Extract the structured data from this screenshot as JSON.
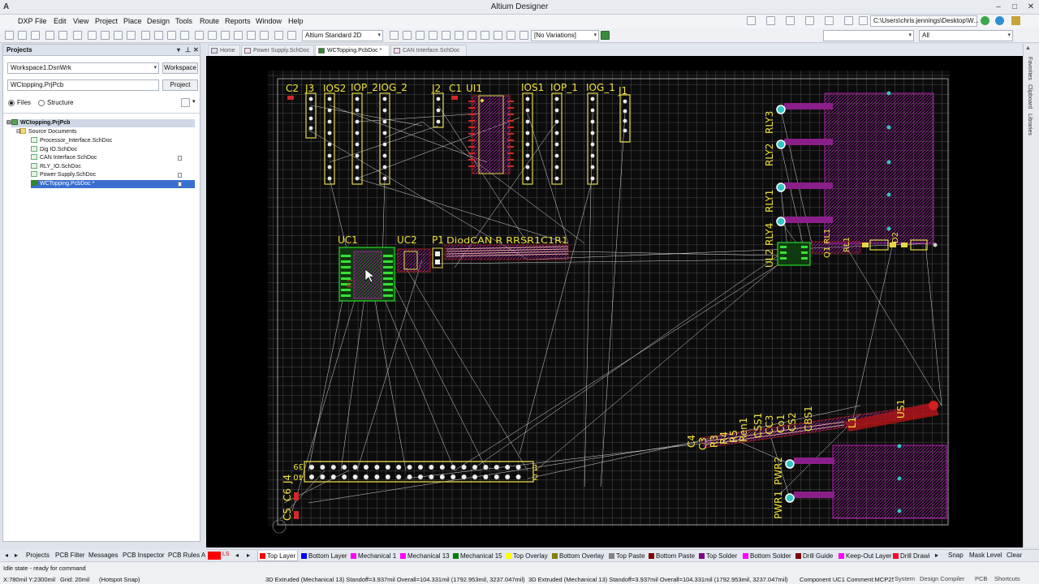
{
  "window": {
    "title": "Altium Designer"
  },
  "menu": [
    "DXP",
    "File",
    "Edit",
    "View",
    "Project",
    "Place",
    "Design",
    "Tools",
    "Route",
    "Reports",
    "Window",
    "Help"
  ],
  "toolbar": {
    "view_config": "Altium Standard 2D",
    "variations": "[No Variations]",
    "path": "C:\\Users\\chris.jennings\\Desktop\\W...",
    "filter_all": "All"
  },
  "projects_panel": {
    "title": "Projects",
    "workspace_combo": "Workspace1.DsnWrk",
    "workspace_button": "Workspace",
    "project_field": "WCtopping.PrjPcb",
    "project_button": "Project",
    "view_files": "Files",
    "view_structure": "Structure",
    "tree": {
      "project": "WCtopping.PrjPcb",
      "folder": "Source Documents",
      "docs": [
        "Processor_Interface.SchDoc",
        "Dig IO.SchDoc",
        "CAN Interface.SchDoc",
        "RLY_IO.SchDoc",
        "Power Supply.SchDoc",
        "WCTopping.PcbDoc *"
      ]
    }
  },
  "doc_tabs": [
    "Home",
    "Power Supply.SchDoc",
    "WCTopping.PcbDoc *",
    "CAN Interface.SchDoc"
  ],
  "right_strip": [
    "Favorites",
    "Clipboard",
    "Libraries"
  ],
  "bottom_panels": [
    "Projects",
    "PCB Filter",
    "Messages",
    "PCB Inspector",
    "PCB Rules An"
  ],
  "layers": {
    "tabs": [
      {
        "name": "Top Layer",
        "color": "#ff0000"
      },
      {
        "name": "Bottom Layer",
        "color": "#0000ff"
      },
      {
        "name": "Mechanical 1",
        "color": "#ff00ff"
      },
      {
        "name": "Mechanical 13",
        "color": "#ff00ff"
      },
      {
        "name": "Mechanical 15",
        "color": "#008000"
      },
      {
        "name": "Top Overlay",
        "color": "#ffff00"
      },
      {
        "name": "Bottom Overlay",
        "color": "#808000"
      },
      {
        "name": "Top Paste",
        "color": "#808080"
      },
      {
        "name": "Bottom Paste",
        "color": "#800000"
      },
      {
        "name": "Top Solder",
        "color": "#800080"
      },
      {
        "name": "Bottom Solder",
        "color": "#ff00ff"
      },
      {
        "name": "Drill Guide",
        "color": "#800000"
      },
      {
        "name": "Keep-Out Layer",
        "color": "#ff00ff"
      },
      {
        "name": "Drill Drawi",
        "color": "#ff002a"
      }
    ],
    "current_color": "#ff0000",
    "ls": "LS",
    "snap": "Snap",
    "mask_level": "Mask Level",
    "clear": "Clear"
  },
  "status": {
    "state": "Idle state - ready for command",
    "coords": "X:780mil Y:2300mil",
    "grid": "Grid: 20mil",
    "snap": "(Hotspot Snap)",
    "info1": "3D Extruded  (Mechanical 13)  Standoff=3.937mil  Overall=104.331mil  (1792.953mil, 3237.047mil)",
    "info2": "3D Extruded  (Mechanical 13)  Standoff=3.937mil  Overall=104.331mil  (1792.953mil, 3237.047mil)",
    "component": "Component UC1 Comment:MCP25",
    "buttons": [
      "System",
      "Design Compiler",
      "PCB",
      "Shortcuts"
    ]
  },
  "board": {
    "designators": {
      "c2": "C2",
      "j3": "J3",
      "ios2": "IOS2",
      "iop2": "IOP_2",
      "iog2": "IOG_2",
      "j2": "J2",
      "c1": "C1",
      "ui1": "UI1",
      "ios1": "IOS1",
      "iop1": "IOP_1",
      "iog1": "IOG_1",
      "j1": "J1",
      "uc1": "UC1",
      "uc2": "UC2",
      "p1": "P1",
      "dense": "DiodCAN R RRSR1C1R1",
      "rly3": "RLY3",
      "rly2": "RLY2",
      "rly1": "RLY1",
      "rly4": "RLY4",
      "ul2": "UL2",
      "rl1": "RL1",
      "qrl": "Q1 RL1",
      "d2": "D2",
      "c4": "C4",
      "c3": "C3",
      "r3": "R3",
      "r4": "R4",
      "r5": "R5",
      "ren1": "Ren1",
      "css1": "CSS1",
      "cc3": "CC3",
      "co1": "Co1",
      "cs2": "CS2",
      "cbs1": "CBS1",
      "l1": "L1",
      "us1": "US1",
      "pwr2": "PWR2",
      "pwr1": "PWR1",
      "j4": "J4",
      "c6": "C6",
      "c5": "C5",
      "h39": "39",
      "h40": "40",
      "h1": "1",
      "h2": "2"
    }
  }
}
